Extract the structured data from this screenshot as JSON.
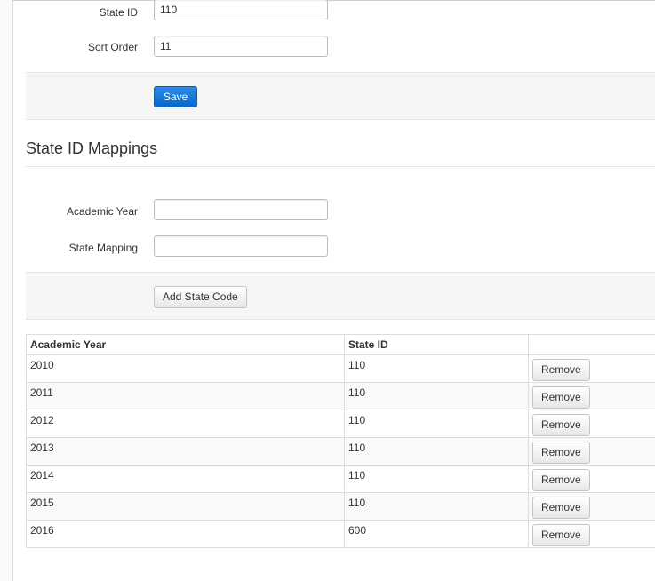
{
  "fields": {
    "state_id": {
      "label": "State ID",
      "value": "110"
    },
    "sort_order": {
      "label": "Sort Order",
      "value": "11"
    }
  },
  "save_label": "Save",
  "mappings": {
    "title": "State ID Mappings",
    "academic_year": {
      "label": "Academic Year",
      "value": ""
    },
    "state_mapping": {
      "label": "State Mapping",
      "value": ""
    },
    "add_label": "Add State Code"
  },
  "table": {
    "headers": [
      "Academic Year",
      "State ID",
      ""
    ],
    "remove_label": "Remove",
    "rows": [
      {
        "year": "2010",
        "state_id": "110"
      },
      {
        "year": "2011",
        "state_id": "110"
      },
      {
        "year": "2012",
        "state_id": "110"
      },
      {
        "year": "2013",
        "state_id": "110"
      },
      {
        "year": "2014",
        "state_id": "110"
      },
      {
        "year": "2015",
        "state_id": "110"
      },
      {
        "year": "2016",
        "state_id": "600"
      }
    ]
  }
}
